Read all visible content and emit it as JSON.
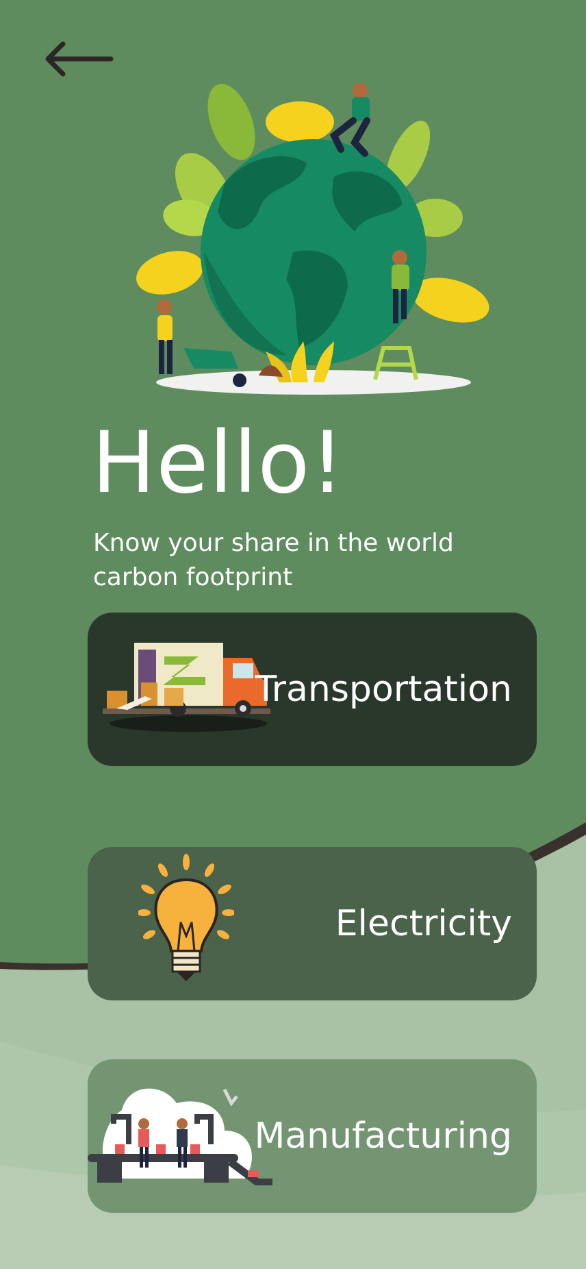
{
  "header": {
    "back_icon": "arrow-left-icon"
  },
  "hero": {
    "illustration": "earth-gardening-illustration"
  },
  "greeting": {
    "title": "Hello!",
    "subtitle_line1": "Know your share in the world",
    "subtitle_line2": "carbon footprint"
  },
  "categories": [
    {
      "label": "Transportation",
      "icon": "delivery-truck-icon"
    },
    {
      "label": "Electricity",
      "icon": "lightbulb-icon"
    },
    {
      "label": "Manufacturing",
      "icon": "factory-assembly-line-icon"
    }
  ],
  "colors": {
    "background_top": "#5e8c5e",
    "background_bottom": "#a9c1a5",
    "wave_edge": "#3a302c",
    "card_transportation": "#2a372b",
    "card_electricity": "#4a634a",
    "card_manufacturing": "#739572",
    "text": "#ffffff"
  }
}
